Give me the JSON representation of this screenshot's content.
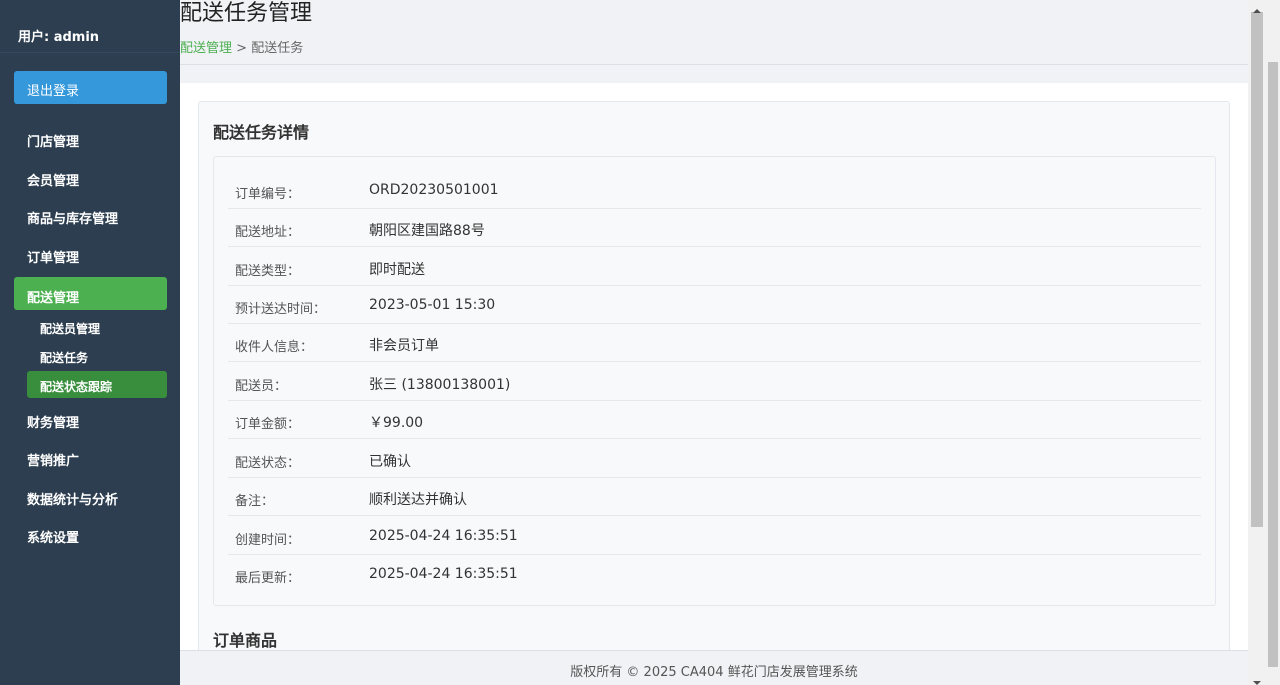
{
  "sidebar": {
    "user_label": "用户: admin",
    "logout_label": "退出登录",
    "items": [
      {
        "label": "门店管理"
      },
      {
        "label": "会员管理"
      },
      {
        "label": "商品与库存管理"
      },
      {
        "label": "订单管理"
      },
      {
        "label": "配送管理"
      },
      {
        "label": "财务管理"
      },
      {
        "label": "营销推广"
      },
      {
        "label": "数据统计与分析"
      },
      {
        "label": "系统设置"
      }
    ],
    "sub_items": [
      {
        "label": "配送员管理"
      },
      {
        "label": "配送任务"
      },
      {
        "label": "配送状态跟踪"
      }
    ]
  },
  "header": {
    "title": "配送任务管理",
    "breadcrumb_link": "配送管理",
    "breadcrumb_sep": ">",
    "breadcrumb_current": "配送任务"
  },
  "detail": {
    "card_title": "配送任务详情",
    "rows": [
      {
        "label": "订单编号：",
        "value": "ORD20230501001"
      },
      {
        "label": "配送地址：",
        "value": "朝阳区建国路88号"
      },
      {
        "label": "配送类型：",
        "value": "即时配送"
      },
      {
        "label": "预计送达时间：",
        "value": "2023-05-01 15:30"
      },
      {
        "label": "收件人信息：",
        "value": "非会员订单"
      },
      {
        "label": "配送员：",
        "value": "张三 (13800138001)"
      },
      {
        "label": "订单金额：",
        "value": "￥99.00"
      },
      {
        "label": "配送状态：",
        "value": "已确认"
      },
      {
        "label": "备注：",
        "value": "顺利送达并确认"
      },
      {
        "label": "创建时间：",
        "value": "2025-04-24 16:35:51"
      },
      {
        "label": "最后更新：",
        "value": "2025-04-24 16:35:51"
      }
    ],
    "products_title": "订单商品"
  },
  "footer": {
    "text": "版权所有 © 2025 CA404 鲜花门店发展管理系统"
  },
  "colors": {
    "sidebar_bg": "#2c3e50",
    "logout_bg": "#3498db",
    "active_bg": "#4caf50",
    "active_sub_bg": "#388e3c",
    "breadcrumb_link": "#4caf50"
  }
}
